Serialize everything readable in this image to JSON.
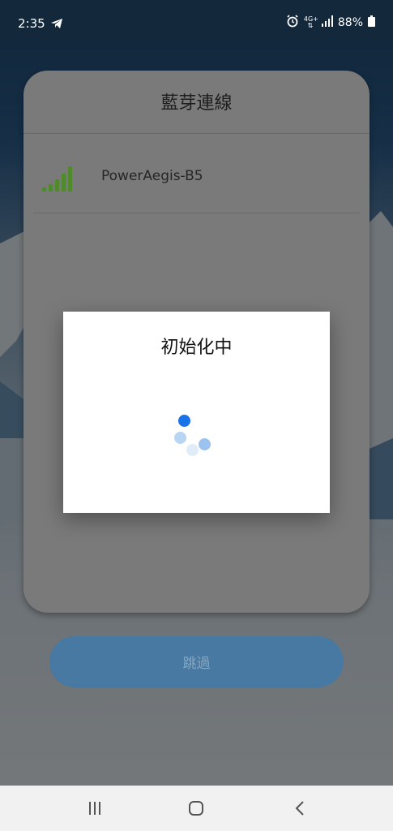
{
  "status_bar": {
    "time": "2:35",
    "network": "4G+",
    "battery": "88%",
    "icons": [
      "telegram-icon",
      "alarm-icon",
      "network-4g-icon",
      "signal-icon",
      "battery-icon"
    ]
  },
  "card": {
    "title": "藍芽連線",
    "devices": [
      {
        "name": "PowerAegis-B5",
        "icon": "signal-strength-icon"
      }
    ]
  },
  "skip_button": {
    "label": "跳過"
  },
  "dialog": {
    "title": "初始化中",
    "icon": "loading-spinner-icon"
  },
  "nav_bar": {
    "icons": [
      "recent-apps-icon",
      "home-icon",
      "back-icon"
    ]
  },
  "colors": {
    "accent": "#1a73e8",
    "signal": "#4f8a2b",
    "skip_button_bg": "#4779a2"
  }
}
